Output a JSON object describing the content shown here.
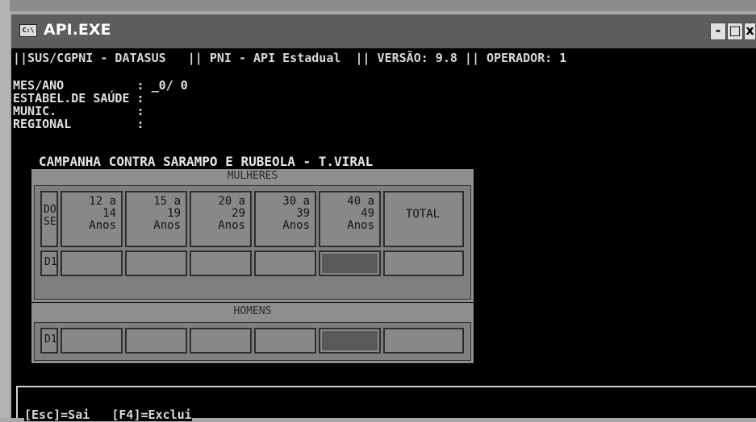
{
  "window": {
    "icon_text": "C:\\",
    "title": "API.EXE",
    "min_label": "-",
    "max_label": "□",
    "close_label": "x"
  },
  "header": "||SUS/CGPNI - DATASUS   || PNI - API Estadual  || VERSÃO: 9.8 || OPERADOR: 1",
  "fields": [
    {
      "label": "MES/ANO          : ",
      "value": "_0/ 0"
    },
    {
      "label": "ESTABEL.DE SAÚDE :",
      "value": ""
    },
    {
      "label": "MUNIC.           :",
      "value": ""
    },
    {
      "label": "REGIONAL         :",
      "value": ""
    }
  ],
  "campaign_title": "CAMPANHA CONTRA SARAMPO E RUBEOLA - T.VIRAL",
  "women": {
    "title": "MULHERES",
    "dose_header": "DO\nSE",
    "columns": [
      "12 a\n  14\nAnos",
      "15 a\n  19\nAnos",
      "20 a\n  29\nAnos",
      "30 a\n  39\nAnos",
      "40 a\n  49\nAnos"
    ],
    "total_header": "TOTAL",
    "row_label": "D1"
  },
  "men": {
    "title": "HOMENS",
    "row_label": "D1"
  },
  "footer": "[Esc]=Sai   [F4]=Exclui"
}
